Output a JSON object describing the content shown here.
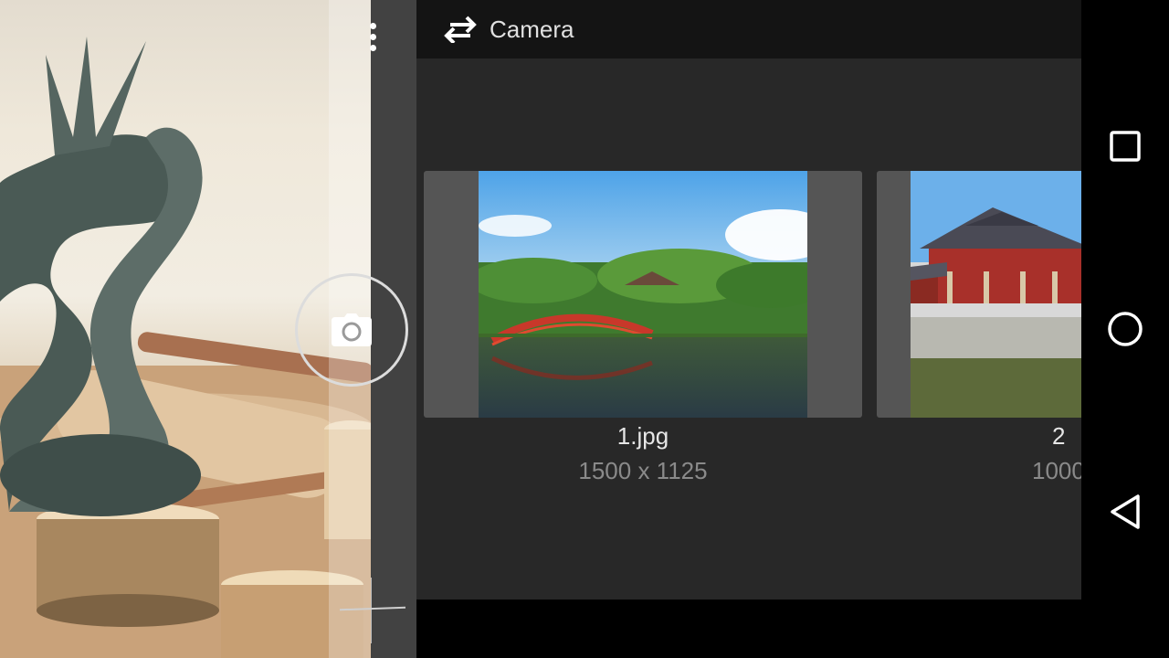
{
  "camera": {
    "menu_icon": "more-vert-icon",
    "shutter_icon": "camera-icon"
  },
  "toolbar": {
    "swap_icon": "swap-horiz-icon",
    "title": "Camera"
  },
  "gallery": {
    "items": [
      {
        "name": "1.jpg",
        "dimensions": "1500 x 1125"
      },
      {
        "name": "2",
        "dimensions": "1000"
      }
    ]
  },
  "navigation": {
    "buttons": [
      "recents-square-icon",
      "home-circle-icon",
      "back-triangle-icon"
    ]
  },
  "colors": {
    "panel_bg": "#282828",
    "toolbar_bg": "#141414",
    "card_bg": "#555555"
  }
}
